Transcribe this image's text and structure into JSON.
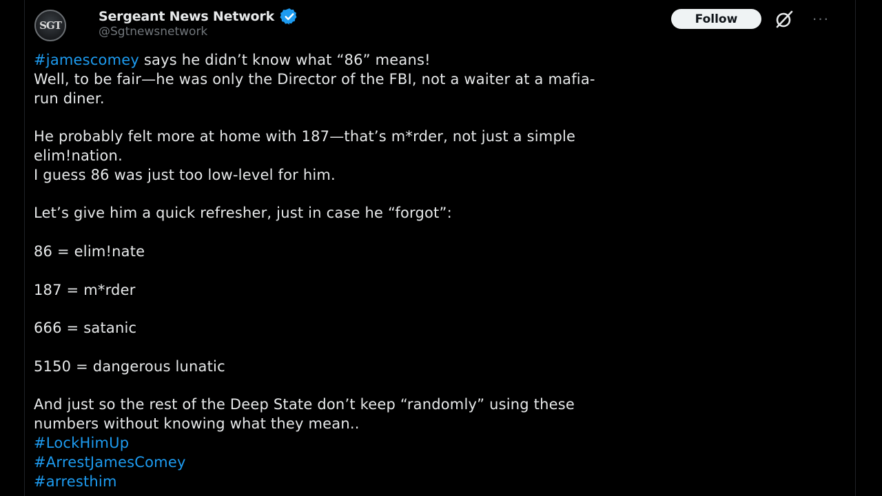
{
  "theme": {
    "background": "#000000",
    "text": "#e7e9ea",
    "secondary": "#71767b",
    "link": "#1d9bf0",
    "verified": "#1d9bf0",
    "follow_bg": "#eff3f4"
  },
  "author": {
    "avatar_text": "SGT",
    "display_name": "Sergeant News Network",
    "handle": "@Sgtnewsnetwork",
    "verified_icon": "verified-badge-icon"
  },
  "header": {
    "follow_label": "Follow",
    "grok_icon": "grok-icon",
    "more_icon": "more-icon",
    "more_label": "···"
  },
  "post": {
    "line1_hashtag": "#jamescomey",
    "line1_text": " says he didn’t know what “86” means!",
    "line2": "Well, to be fair—he was only the Director of the FBI, not a waiter at a mafia-",
    "line3": "run diner.",
    "line4": "He probably felt more at home with 187—that’s m*rder, not just a simple",
    "line5": "elim!nation.",
    "line6": "I guess 86 was just too low-level for him.",
    "line7": "Let’s give him a quick refresher, just in case he “forgot”:",
    "code1": "86 = elim!nate",
    "code2": "187 = m*rder",
    "code3": "666 = satanic",
    "code4": "5150 = dangerous lunatic",
    "line8": "And just so the rest of the Deep State don’t keep “randomly” using these",
    "line9": "numbers without knowing what they mean..",
    "hashtags": [
      "#LockHimUp",
      "#ArrestJamesComey",
      "#arresthim"
    ]
  }
}
